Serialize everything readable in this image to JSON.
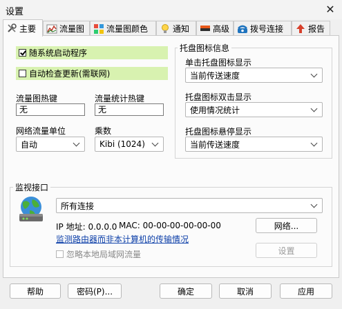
{
  "window": {
    "title": "设置",
    "close_glyph": "✕"
  },
  "tabs": [
    {
      "label": "主要",
      "icon": "tools-icon"
    },
    {
      "label": "流量图",
      "icon": "chart-icon"
    },
    {
      "label": "流量图颜色",
      "icon": "palette-icon"
    },
    {
      "label": "通知",
      "icon": "lightbulb-icon"
    },
    {
      "label": "高级",
      "icon": "flag-icon"
    },
    {
      "label": "拨号连接",
      "icon": "phone-icon"
    },
    {
      "label": "报告",
      "icon": "upload-icon"
    }
  ],
  "main": {
    "autostart": {
      "label": "随系统启动程序",
      "checked": true
    },
    "autoupdate": {
      "label": "自动检查更新(需联网)",
      "checked": false
    },
    "graph_hotkey": {
      "label": "流量图热键",
      "value": "无"
    },
    "stats_hotkey": {
      "label": "流量统计热键",
      "value": "无"
    },
    "unit": {
      "label": "网络流量单位",
      "value": "自动"
    },
    "multiplier": {
      "label": "乘数",
      "value": "Kibi (1024)"
    }
  },
  "tray": {
    "group_label": "托盘图标信息",
    "single_click": {
      "label": "单击托盘图标显示",
      "value": "当前传送速度"
    },
    "double_click": {
      "label": "托盘图标双击显示",
      "value": "使用情况统计"
    },
    "hover": {
      "label": "托盘图标悬停显示",
      "value": "当前传送速度"
    }
  },
  "monitor": {
    "group_label": "监视接口",
    "interface": "所有连接",
    "ip_text": "IP 地址: 0.0.0.0",
    "mac_text": "MAC: 00-00-00-00-00-00",
    "network_button": "网络...",
    "router_link": "监测路由器而非本计算机的传输情况",
    "settings_button": "设置",
    "ignore_local": {
      "label": "忽略本地局域网流量",
      "checked": false
    }
  },
  "footer": {
    "help": "帮助",
    "password": "密码(P)...",
    "ok": "确定",
    "cancel": "取消",
    "apply": "应用"
  },
  "colors": {
    "highlight": "#d8f2b0",
    "link": "#0b3ea8",
    "panel": "#fbfbfb"
  }
}
